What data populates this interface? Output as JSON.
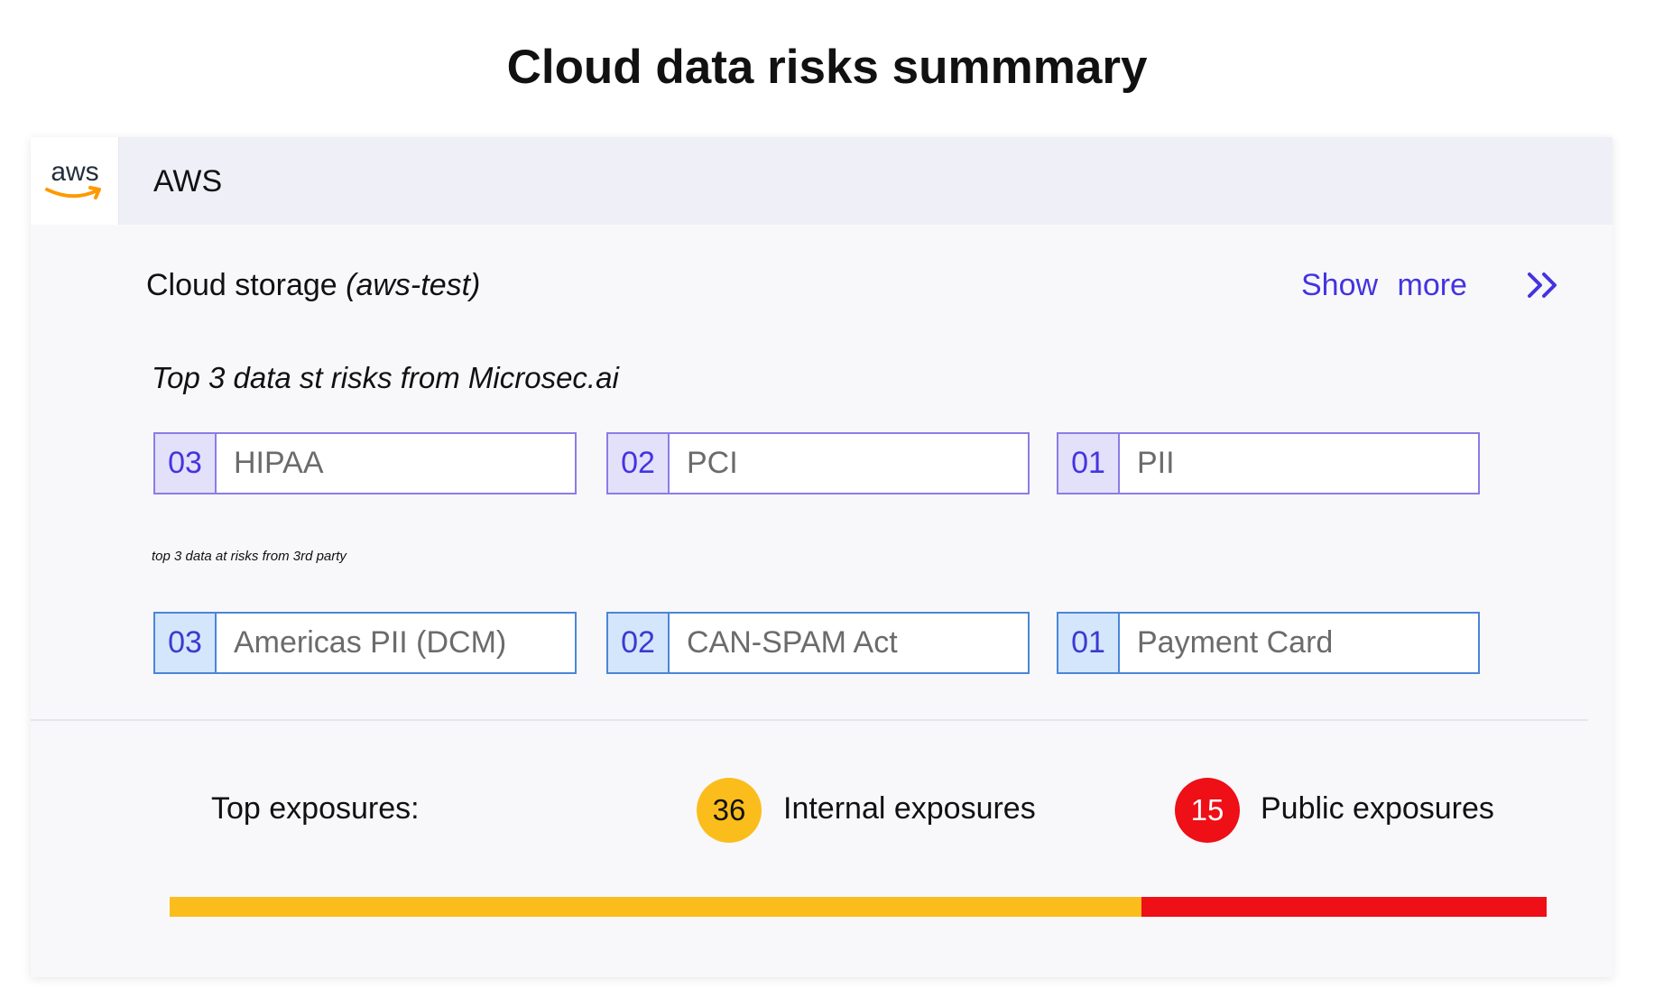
{
  "page_title": "Cloud data risks summmary",
  "provider": {
    "logo_text": "aws",
    "name": "AWS"
  },
  "storage": {
    "title": "Cloud storage",
    "account": "(aws-test)",
    "show_more_label": "Show  more"
  },
  "microsec_risks": {
    "heading": "Top 3 data st risks from Microsec.ai",
    "items": [
      {
        "rank": "03",
        "label": "HIPAA"
      },
      {
        "rank": "02",
        "label": "PCI"
      },
      {
        "rank": "01",
        "label": "PII"
      }
    ]
  },
  "third_party_risks": {
    "heading": "top 3 data at risks from 3rd party",
    "items": [
      {
        "rank": "03",
        "label": "Americas PII (DCM)"
      },
      {
        "rank": "02",
        "label": "CAN-SPAM Act"
      },
      {
        "rank": "01",
        "label": "Payment Card"
      }
    ]
  },
  "exposures": {
    "label": "Top exposures:",
    "internal": {
      "count": 36,
      "count_text": "36",
      "label": "Internal exposures",
      "color": "#fbbd1c"
    },
    "public": {
      "count": 15,
      "count_text": "15",
      "label": "Public exposures",
      "color": "#ee0f17"
    }
  },
  "colors": {
    "accent": "#4434e0",
    "purple_border": "#8c7ce6",
    "blue_border": "#4a86d9",
    "aws_orange": "#ff9900"
  }
}
